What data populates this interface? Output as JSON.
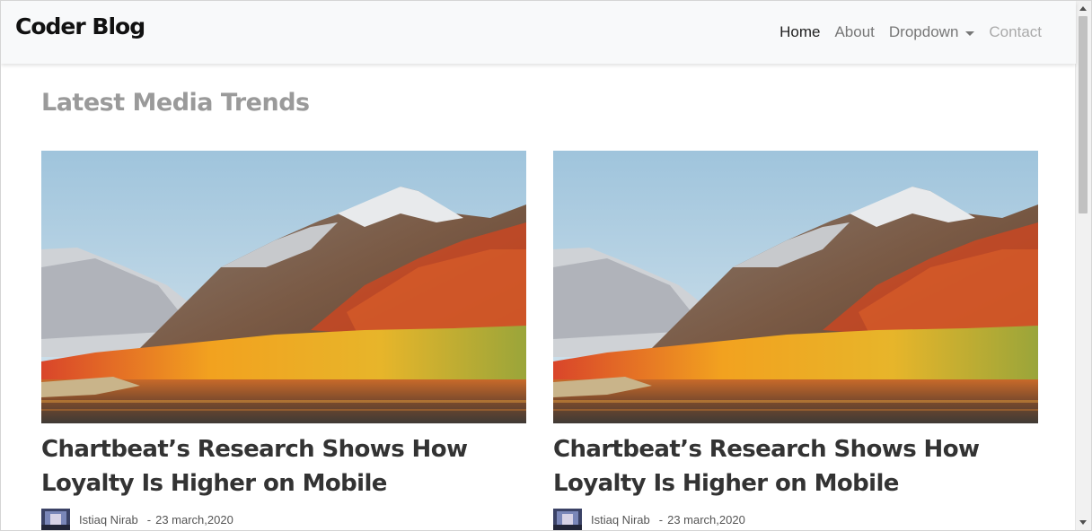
{
  "navbar": {
    "brand": "Coder Blog",
    "items": [
      {
        "label": "Home",
        "state": "active"
      },
      {
        "label": "About",
        "state": "normal"
      },
      {
        "label": "Dropdown",
        "state": "dropdown"
      },
      {
        "label": "Contact",
        "state": "disabled"
      }
    ]
  },
  "main": {
    "section_title": "Latest Media Trends",
    "posts": [
      {
        "title": "Chartbeat’s Research Shows How Loyalty Is Higher on Mobile",
        "author": "Istiaq Nirab",
        "separator": "-",
        "date": "23 march,2020",
        "image": "mountain-lake-landscape"
      },
      {
        "title": "Chartbeat’s Research Shows How Loyalty Is Higher on Mobile",
        "author": "Istiaq Nirab",
        "separator": "-",
        "date": "23 march,2020",
        "image": "mountain-lake-landscape"
      }
    ]
  },
  "colors": {
    "navbar_bg": "#f8f9fa",
    "title_gray": "#9a9a9a",
    "text_dark": "#333333"
  }
}
